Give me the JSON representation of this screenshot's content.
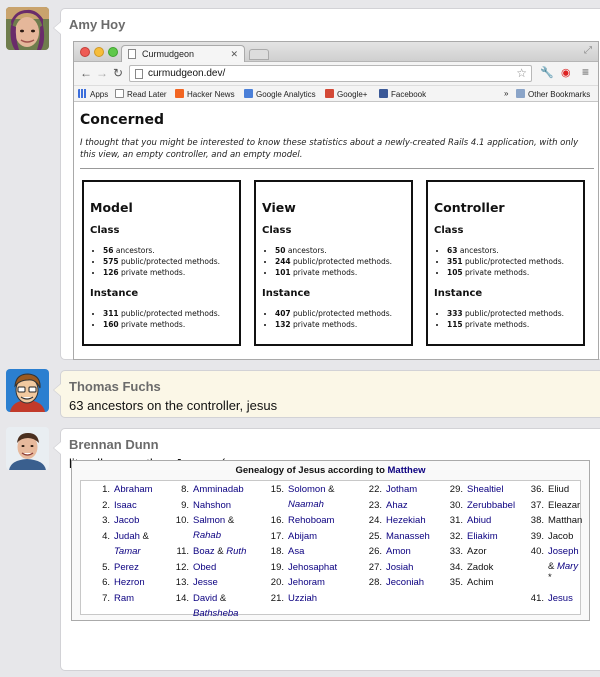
{
  "messages": [
    {
      "author": "Amy Hoy"
    },
    {
      "author": "Thomas Fuchs",
      "text": "63 ancestors on the controller, jesus"
    },
    {
      "author": "Brennan Dunn",
      "text": "literally more than Jesus :-("
    }
  ],
  "browser": {
    "tab_title": "Curmudgeon",
    "url": "curmudgeon.dev/",
    "bookmarks": [
      "Apps",
      "Read Later",
      "Hacker News",
      "Google Analytics",
      "Google+",
      "Facebook"
    ],
    "bookmark_overflow": "»",
    "other_bookmarks": "Other Bookmarks",
    "page": {
      "heading": "Concerned",
      "intro": "I thought that you might be interested to know these statistics about a newly-created Rails 4.1 application, with only this view, an empty controller, and an empty model.",
      "class_label": "Class",
      "instance_label": "Instance",
      "columns": [
        {
          "title": "Model",
          "class_items": [
            [
              "56",
              " ancestors."
            ],
            [
              "575",
              " public/protected methods."
            ],
            [
              "126",
              " private methods."
            ]
          ],
          "instance_items": [
            [
              "311",
              " public/protected methods."
            ],
            [
              "160",
              " private methods."
            ]
          ]
        },
        {
          "title": "View",
          "class_items": [
            [
              "50",
              " ancestors."
            ],
            [
              "244",
              " public/protected methods."
            ],
            [
              "101",
              " private methods."
            ]
          ],
          "instance_items": [
            [
              "407",
              " public/protected methods."
            ],
            [
              "132",
              " private methods."
            ]
          ]
        },
        {
          "title": "Controller",
          "class_items": [
            [
              "63",
              " ancestors."
            ],
            [
              "351",
              " public/protected methods."
            ],
            [
              "105",
              " private methods."
            ]
          ],
          "instance_items": [
            [
              "333",
              " public/protected methods."
            ],
            [
              "115",
              " private methods."
            ]
          ]
        }
      ]
    }
  },
  "genealogy": {
    "title_prefix": "Genealogy of Jesus according to ",
    "title_link": "Matthew",
    "columns": [
      [
        {
          "n": "1.",
          "name": "Abraham"
        },
        {
          "n": "2.",
          "name": "Isaac"
        },
        {
          "n": "3.",
          "name": "Jacob"
        },
        {
          "n": "4.",
          "name": "Judah",
          "and": " &",
          "spouse": "Tamar"
        },
        {
          "n": "5.",
          "name": "Perez"
        },
        {
          "n": "6.",
          "name": "Hezron"
        },
        {
          "n": "7.",
          "name": "Ram"
        }
      ],
      [
        {
          "n": "8.",
          "name": "Amminadab"
        },
        {
          "n": "9.",
          "name": "Nahshon"
        },
        {
          "n": "10.",
          "name": "Salmon",
          "and": " &",
          "spouse": "Rahab"
        },
        {
          "n": "11.",
          "name": "Boaz",
          "and": " & ",
          "inline_spouse": "Ruth"
        },
        {
          "n": "12.",
          "name": "Obed"
        },
        {
          "n": "13.",
          "name": "Jesse"
        },
        {
          "n": "14.",
          "name": "David",
          "and": " &",
          "spouse": "Bathsheba"
        }
      ],
      [
        {
          "n": "15.",
          "name": "Solomon",
          "and": " &",
          "spouse": "Naamah"
        },
        {
          "n": "16.",
          "name": "Rehoboam"
        },
        {
          "n": "17.",
          "name": "Abijam"
        },
        {
          "n": "18.",
          "name": "Asa"
        },
        {
          "n": "19.",
          "name": "Jehosaphat"
        },
        {
          "n": "20.",
          "name": "Jehoram"
        },
        {
          "n": "21.",
          "name": "Uzziah"
        }
      ],
      [
        {
          "n": "22.",
          "name": "Jotham"
        },
        {
          "n": "23.",
          "name": "Ahaz"
        },
        {
          "n": "24.",
          "name": "Hezekiah"
        },
        {
          "n": "25.",
          "name": "Manasseh"
        },
        {
          "n": "26.",
          "name": "Amon"
        },
        {
          "n": "27.",
          "name": "Josiah"
        },
        {
          "n": "28.",
          "name": "Jeconiah"
        }
      ],
      [
        {
          "n": "29.",
          "name": "Shealtiel"
        },
        {
          "n": "30.",
          "name": "Zerubbabel"
        },
        {
          "n": "31.",
          "name": "Abiud"
        },
        {
          "n": "32.",
          "name": "Eliakim"
        },
        {
          "n": "33.",
          "name": "Azor",
          "plain": true
        },
        {
          "n": "34.",
          "name": "Zadok",
          "plain": true
        },
        {
          "n": "35.",
          "name": "Achim",
          "plain": true
        }
      ],
      [
        {
          "n": "36.",
          "name": "Eliud",
          "plain": true
        },
        {
          "n": "37.",
          "name": "Eleazar",
          "plain": true
        },
        {
          "n": "38.",
          "name": "Matthan",
          "plain": true
        },
        {
          "n": "39.",
          "name": "Jacob",
          "plain": true
        },
        {
          "n": "40.",
          "name": "Joseph",
          "and": "&",
          "spouse": "Mary",
          "note": "*"
        },
        {
          "n": "41.",
          "name": "Jesus"
        }
      ]
    ]
  },
  "colors": {
    "link": "#0b0080",
    "highlight": "#fbf7e7",
    "background": "#e7e7ea"
  },
  "icons": [
    "browser-close-light",
    "browser-minimize-light",
    "browser-zoom-light",
    "back-arrow-icon",
    "forward-arrow-icon",
    "reload-icon",
    "star-icon",
    "wrench-icon",
    "opera-icon",
    "menu-icon",
    "folder-icon"
  ]
}
